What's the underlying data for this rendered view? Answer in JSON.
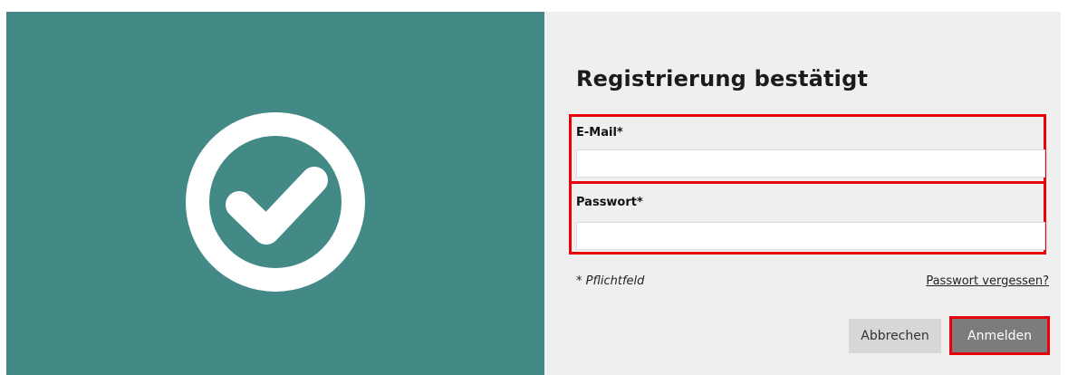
{
  "colors": {
    "left_panel": "#438a87",
    "right_panel": "#efefef",
    "highlight": "#e8000b",
    "primary_button": "#7c7c7c",
    "secondary_button": "#d7d7d7"
  },
  "icons": {
    "success": "check-circle-icon"
  },
  "form": {
    "title": "Registrierung bestätigt",
    "email": {
      "label": "E-Mail*",
      "value": ""
    },
    "password": {
      "label": "Passwort*",
      "value": ""
    },
    "required_note": "* Pflichtfeld",
    "forgot_password": "Passwort vergessen?",
    "cancel_label": "Abbrechen",
    "login_label": "Anmelden"
  }
}
